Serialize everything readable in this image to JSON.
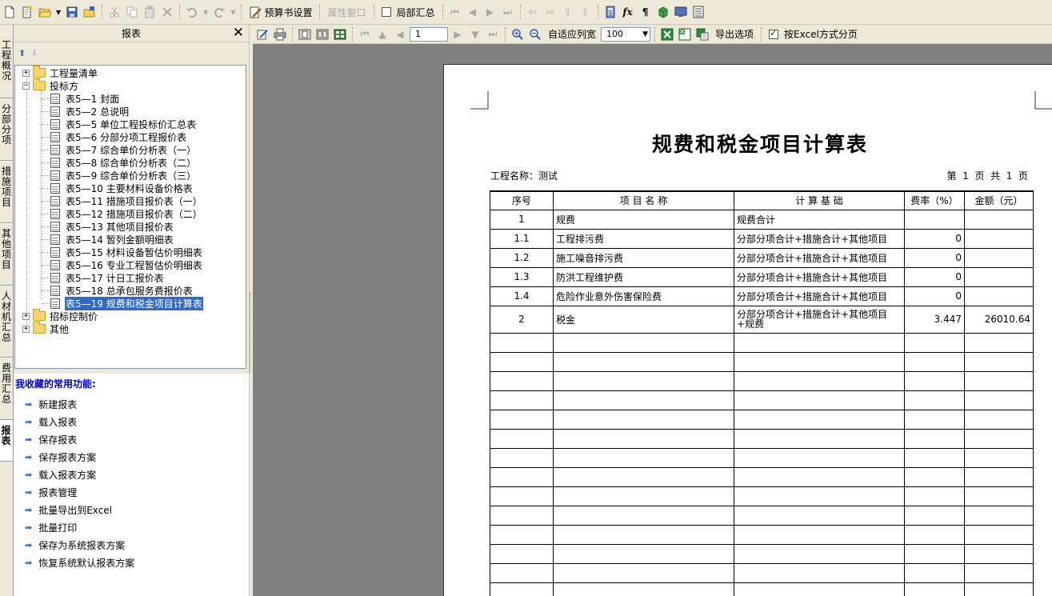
{
  "toolbar": {
    "budget_settings": "预算书设置",
    "property_window": "属性窗口",
    "local_summary": "局部汇总"
  },
  "vertical_tabs": [
    "工程概况",
    "分部分项",
    "措施项目",
    "其他项目",
    "人材机汇总",
    "费用汇总",
    "报表"
  ],
  "panel": {
    "title": "报表"
  },
  "tree": [
    {
      "label": "工程量清单",
      "type": "folder",
      "expanded": false
    },
    {
      "label": "投标方",
      "type": "folder",
      "expanded": true
    },
    {
      "label": "表5—1 封面",
      "type": "doc"
    },
    {
      "label": "表5—2 总说明",
      "type": "doc"
    },
    {
      "label": "表5—5 单位工程投标价汇总表",
      "type": "doc"
    },
    {
      "label": "表5—6 分部分项工程报价表",
      "type": "doc"
    },
    {
      "label": "表5—7 综合单价分析表（一）",
      "type": "doc"
    },
    {
      "label": "表5—8 综合单价分析表（二）",
      "type": "doc"
    },
    {
      "label": "表5—9 综合单价分析表（三）",
      "type": "doc"
    },
    {
      "label": "表5—10 主要材料设备价格表",
      "type": "doc"
    },
    {
      "label": "表5—11 措施项目报价表（一）",
      "type": "doc"
    },
    {
      "label": "表5—12 措施项目报价表（二）",
      "type": "doc"
    },
    {
      "label": "表5—13 其他项目报价表",
      "type": "doc"
    },
    {
      "label": "表5—14 暂列金额明细表",
      "type": "doc"
    },
    {
      "label": "表5—15 材料设备暂估价明细表",
      "type": "doc"
    },
    {
      "label": "表5—16 专业工程暂估价明细表",
      "type": "doc"
    },
    {
      "label": "表5—17 计日工报价表",
      "type": "doc"
    },
    {
      "label": "表5—18 总承包服务费报价表",
      "type": "doc"
    },
    {
      "label": "表5—19 规费和税金项目计算表",
      "type": "doc",
      "selected": true
    },
    {
      "label": "招标控制价",
      "type": "folder",
      "expanded": false
    },
    {
      "label": "其他",
      "type": "folder",
      "expanded": false
    }
  ],
  "favorites": {
    "title": "我收藏的常用功能:",
    "items": [
      "新建报表",
      "载入报表",
      "保存报表",
      "保存报表方案",
      "载入报表方案",
      "报表管理",
      "批量导出到Excel",
      "批量打印",
      "保存为系统报表方案",
      "恢复系统默认报表方案"
    ]
  },
  "preview_toolbar": {
    "page_number": "1",
    "fit_width": "自适应列宽",
    "zoom": "100",
    "export_options": "导出选项",
    "excel_paging": "按Excel方式分页",
    "excel_paging_checked": true
  },
  "report": {
    "title": "规费和税金项目计算表",
    "project_name": "工程名称：测试",
    "page_info": "第  1  页  共  1  页",
    "columns": [
      "序号",
      "项 目 名 称",
      "计 算 基 础",
      "费率（%）",
      "金额（元）"
    ],
    "rows": [
      [
        "1",
        "规费",
        "规费合计",
        "",
        ""
      ],
      [
        "1.1",
        "工程排污费",
        "分部分项合计+措施合计+其他项目",
        "0",
        ""
      ],
      [
        "1.2",
        "施工噪音排污费",
        "分部分项合计+措施合计+其他项目",
        "0",
        ""
      ],
      [
        "1.3",
        "防洪工程维护费",
        "分部分项合计+措施合计+其他项目",
        "0",
        ""
      ],
      [
        "1.4",
        "危险作业意外伤害保险费",
        "分部分项合计+措施合计+其他项目",
        "0",
        ""
      ],
      [
        "2",
        "税金",
        "分部分项合计+措施合计+其他项目+规费",
        "3.447",
        "26010.64"
      ]
    ]
  }
}
